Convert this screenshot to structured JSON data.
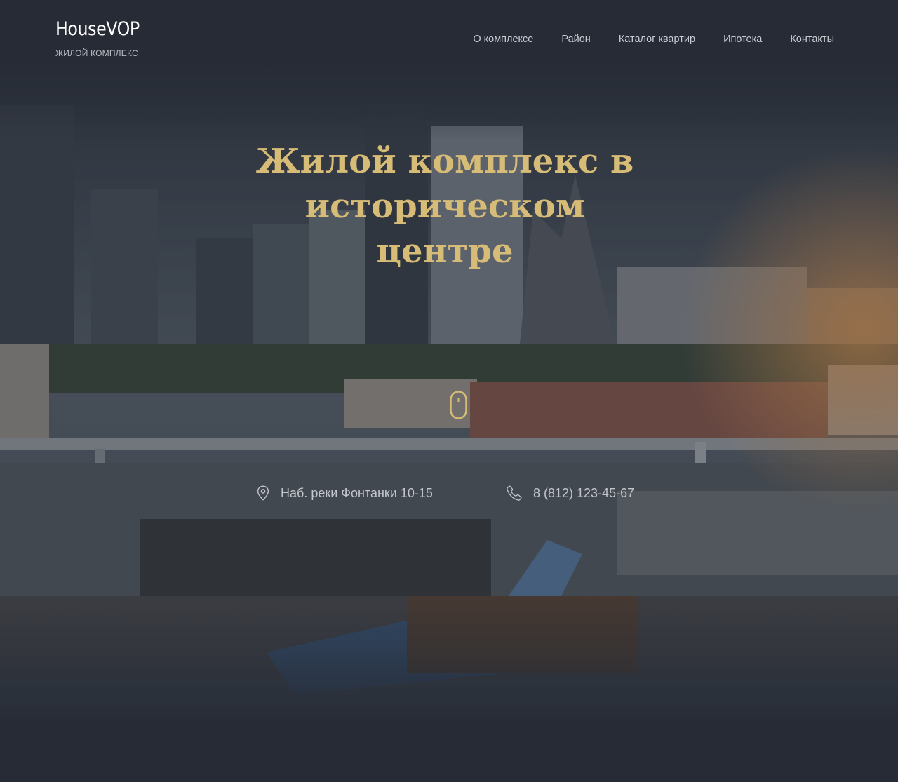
{
  "brand": {
    "name": "HouseVOP",
    "subtitle": "ЖИЛОЙ КОМПЛЕКС"
  },
  "nav": {
    "items": [
      {
        "label": "О комплексе"
      },
      {
        "label": "Район"
      },
      {
        "label": "Каталог квартир"
      },
      {
        "label": "Ипотека"
      },
      {
        "label": "Контакты"
      }
    ]
  },
  "hero": {
    "title_lines": [
      "Жилой комплекс в",
      "историческом",
      "центре"
    ],
    "scroll_icon": "mouse-icon"
  },
  "contacts": {
    "address": {
      "icon": "location-pin-icon",
      "text": "Наб. реки Фонтанки 10-15"
    },
    "phone": {
      "icon": "phone-icon",
      "text": "8 (812) 123-45-67"
    }
  },
  "colors": {
    "background": "#262b35",
    "accent_gold": "#d7bc77",
    "nav_text": "#c9ccd2",
    "logo_text": "#ffffff"
  }
}
